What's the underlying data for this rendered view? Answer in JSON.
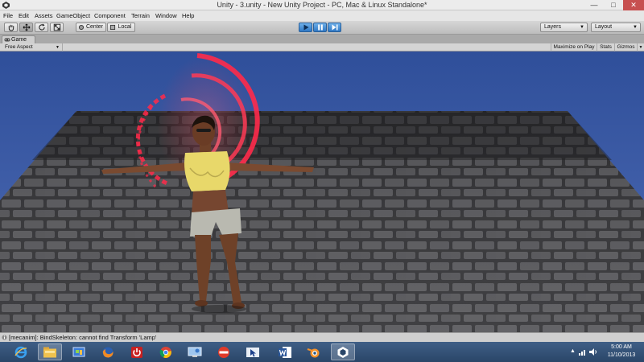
{
  "window": {
    "title": "Unity - 3.unity - New Unity Project - PC, Mac & Linux Standalone*",
    "minimize": "—",
    "maximize": "□",
    "close": "✕"
  },
  "menu": [
    "File",
    "Edit",
    "Assets",
    "GameObject",
    "Component",
    "Terrain",
    "Window",
    "Help"
  ],
  "toolbar": {
    "tools": [
      "hand-icon",
      "move-icon",
      "rotate-icon",
      "scale-icon"
    ],
    "pivot_label": "Center",
    "space_label": "Local",
    "play_icon": "play-icon",
    "pause_icon": "pause-icon",
    "step_icon": "step-icon",
    "layers_label": "Layers",
    "layout_label": "Layout"
  },
  "game_view": {
    "tab_label": "Game",
    "aspect_label": "Free Aspect",
    "maximize_label": "Maximize on Play",
    "stats_label": "Stats",
    "gizmos_label": "Gizmos"
  },
  "console": {
    "message": "[mecanim]: BindSkeleton: cannot find Transform 'Lamp'"
  },
  "taskbar": {
    "apps": [
      "internet-explorer-icon",
      "file-explorer-icon",
      "control-panel-icon",
      "firefox-icon",
      "power-icon",
      "chrome-icon",
      "remote-desktop-icon",
      "nero-icon",
      "mouse-app-icon",
      "word-icon",
      "blender-icon",
      "unity-icon"
    ],
    "time": "5:00 AM",
    "date": "11/10/2013"
  },
  "colors": {
    "sky": "#3a5aa6",
    "floor": "#5a5a5e",
    "play_blue": "#2f78c4",
    "hologram": "#ff2a4a",
    "shirt": "#e8d86a"
  }
}
